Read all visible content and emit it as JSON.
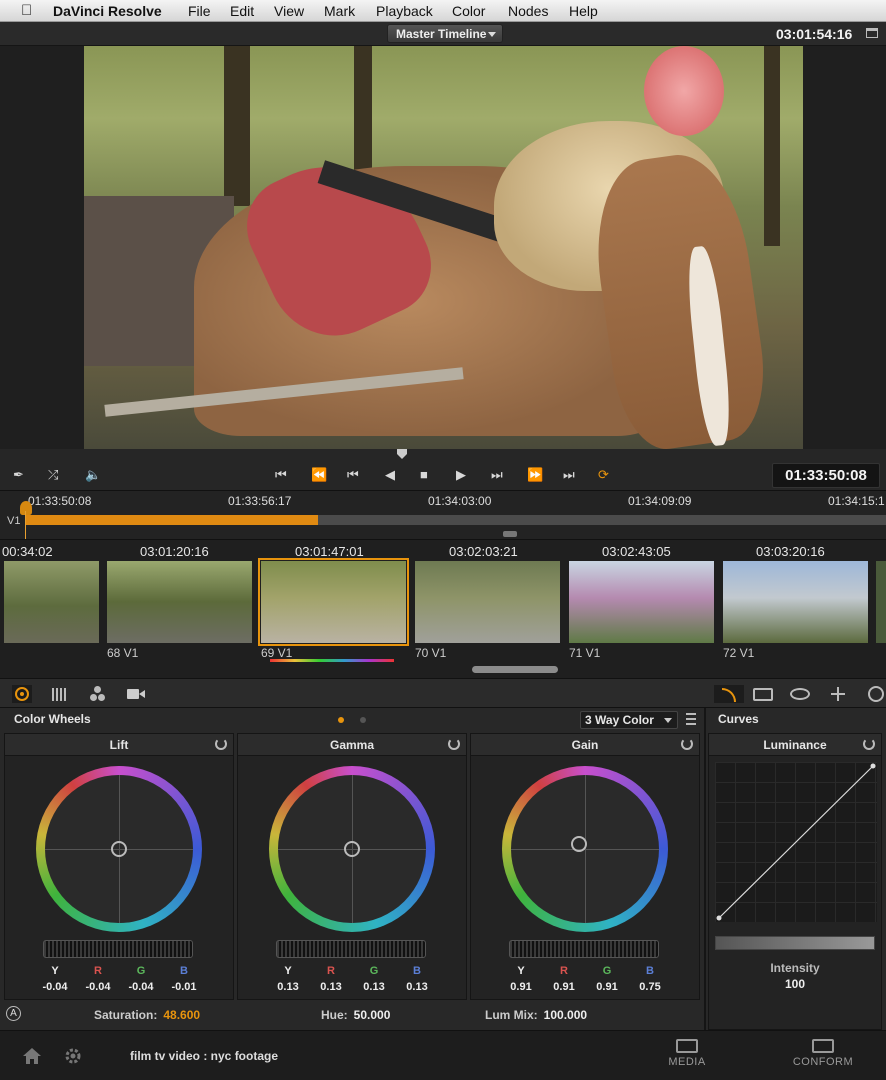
{
  "menubar": {
    "app": "DaVinci Resolve",
    "items": [
      "File",
      "Edit",
      "View",
      "Mark",
      "Playback",
      "Color",
      "Nodes",
      "Help"
    ]
  },
  "viewer": {
    "timeline_select": "Master Timeline",
    "timecode": "03:01:54:16"
  },
  "transport": {
    "timecode": "01:33:50:08"
  },
  "mini_timeline": {
    "ticks": [
      "01:33:50:08",
      "01:33:56:17",
      "01:34:03:00",
      "01:34:09:09",
      "01:34:15:1"
    ],
    "track": "V1",
    "progress": 0.34
  },
  "clips": [
    {
      "tc": "00:34:02",
      "label": ""
    },
    {
      "tc": "03:01:20:16",
      "label": "68  V1"
    },
    {
      "tc": "03:01:47:01",
      "label": "69  V1",
      "selected": true
    },
    {
      "tc": "03:02:03:21",
      "label": "70  V1"
    },
    {
      "tc": "03:02:43:05",
      "label": "71  V1"
    },
    {
      "tc": "03:03:20:16",
      "label": "72  V1"
    }
  ],
  "color_wheels": {
    "title": "Color Wheels",
    "mode": "3 Way Color",
    "wheels": [
      {
        "name": "Lift",
        "y": "-0.04",
        "r": "-0.04",
        "g": "-0.04",
        "b": "-0.01"
      },
      {
        "name": "Gamma",
        "y": "0.13",
        "r": "0.13",
        "g": "0.13",
        "b": "0.13"
      },
      {
        "name": "Gain",
        "y": "0.91",
        "r": "0.91",
        "g": "0.91",
        "b": "0.75"
      }
    ],
    "channels": [
      "Y",
      "R",
      "G",
      "B"
    ],
    "auto_badge": "A",
    "saturation_label": "Saturation:",
    "saturation": "48.600",
    "hue_label": "Hue:",
    "hue": "50.000",
    "lummix_label": "Lum Mix:",
    "lummix": "100.000"
  },
  "curves": {
    "title": "Curves",
    "sub": "Luminance",
    "intensity_label": "Intensity",
    "intensity": "100"
  },
  "footer": {
    "project": "film tv video : nyc footage",
    "media": "MEDIA",
    "conform": "CONFORM"
  },
  "colors": {
    "accent": "#e8940d",
    "channel_r": "#d9534f",
    "channel_g": "#5cb85c",
    "channel_b": "#5b7fd6"
  }
}
